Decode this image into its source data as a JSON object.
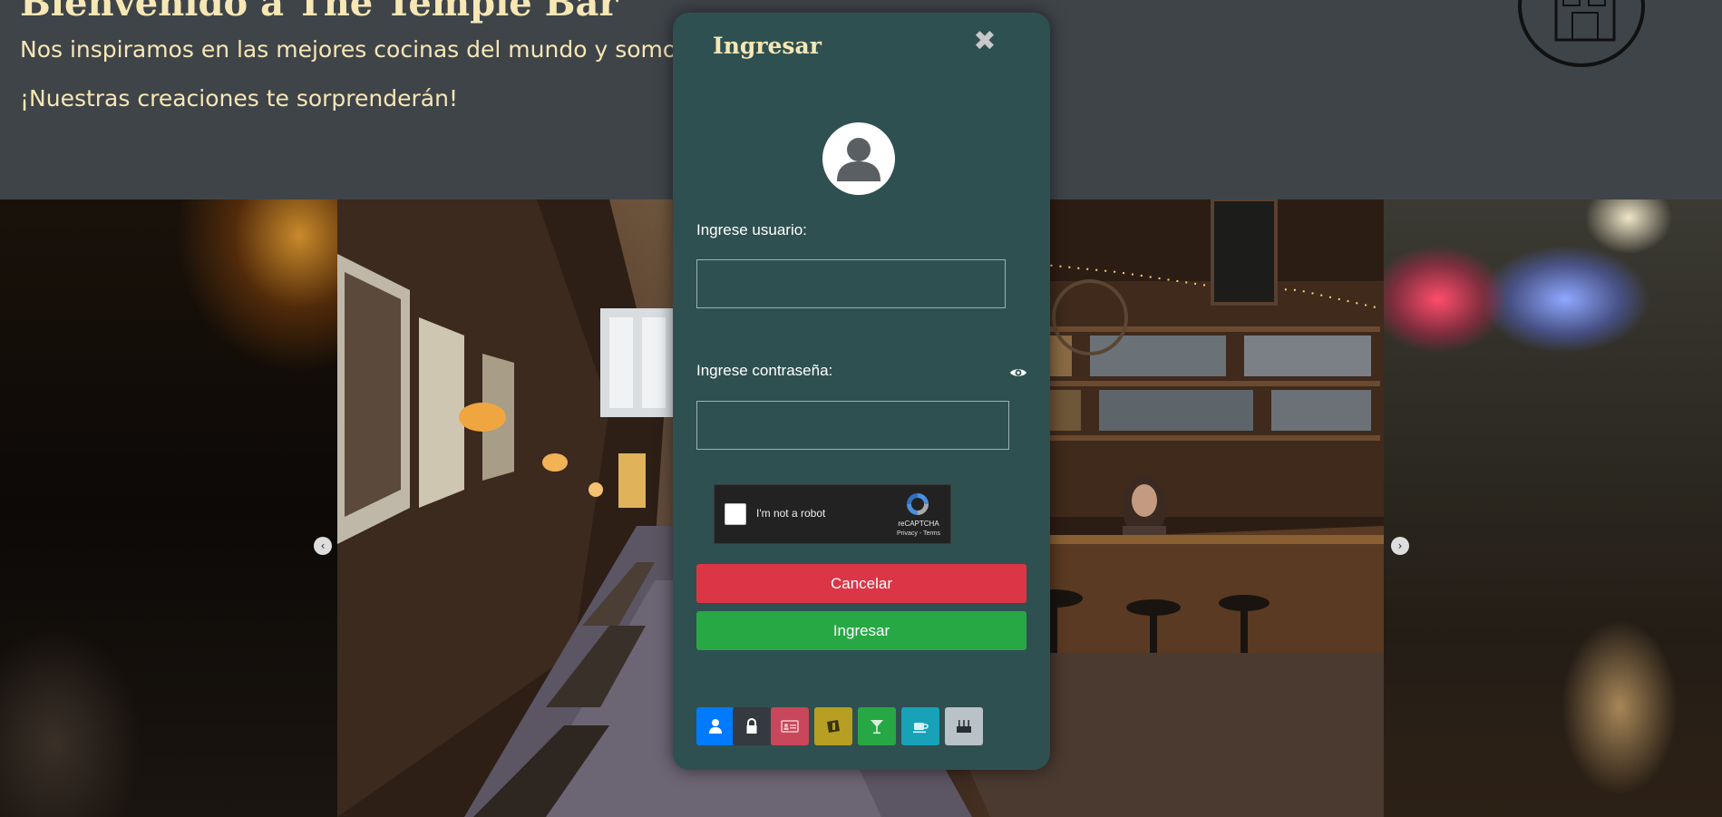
{
  "header": {
    "title": "Bienvenido a The Temple Bar",
    "line1": "Nos inspiramos en las mejores cocinas del mundo y somos",
    "line2": "¡Nuestras creaciones te sorprenderán!"
  },
  "carousel": {
    "prev_icon": "chevron-left-icon",
    "next_icon": "chevron-right-icon",
    "prev_glyph": "‹",
    "next_glyph": "›"
  },
  "modal": {
    "title": "Ingresar",
    "close_glyph": "✖",
    "user_label": "Ingrese usuario:",
    "user_value": "",
    "pass_label": "Ingrese contraseña:",
    "pass_value": "",
    "recaptcha": {
      "label": "I'm not a robot",
      "brand": "reCAPTCHA",
      "links": "Privacy - Terms"
    },
    "cancel_label": "Cancelar",
    "login_label": "Ingresar",
    "icon_buttons": [
      {
        "icon": "user-icon",
        "color": "#007bff"
      },
      {
        "icon": "lock-icon",
        "color": "#343a40"
      },
      {
        "icon": "id-card-icon",
        "color": "#c8475a"
      },
      {
        "icon": "ticket-icon",
        "color": "#b69f22"
      },
      {
        "icon": "cocktail-icon",
        "color": "#28a745"
      },
      {
        "icon": "coffee-icon",
        "color": "#17a2b8"
      },
      {
        "icon": "cake-icon",
        "color": "#b9c2c6"
      }
    ]
  },
  "colors": {
    "header_bg": "#3f4449",
    "header_text": "#f6e7b5",
    "modal_bg": "#2f5050",
    "danger": "#dc3545",
    "success": "#28a745"
  }
}
